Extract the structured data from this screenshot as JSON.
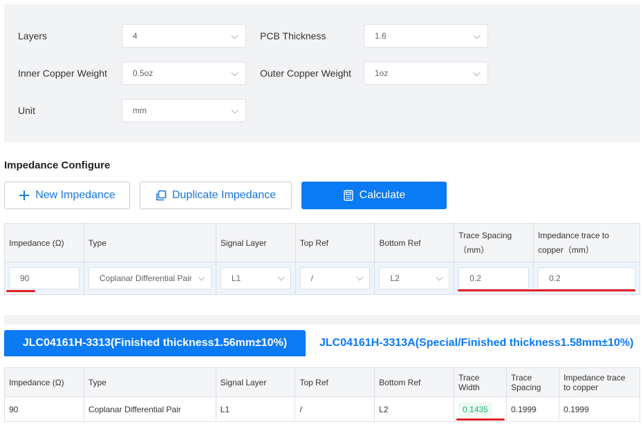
{
  "params": {
    "layers": {
      "label": "Layers",
      "value": "4"
    },
    "pcb_thickness": {
      "label": "PCB Thickness",
      "value": "1.6"
    },
    "inner_copper": {
      "label": "Inner Copper Weight",
      "value": "0.5oz"
    },
    "outer_copper": {
      "label": "Outer Copper Weight",
      "value": "1oz"
    },
    "unit": {
      "label": "Unit",
      "value": "mm"
    }
  },
  "impedance": {
    "title": "Impedance Configure",
    "new_label": "New Impedance",
    "duplicate_label": "Duplicate Impedance",
    "calculate_label": "Calculate",
    "headers": {
      "impedance": "Impedance (Ω)",
      "type": "Type",
      "signal_layer": "Signal Layer",
      "top_ref": "Top Ref",
      "bottom_ref": "Bottom Ref",
      "trace_spacing_1": "Trace Spacing",
      "trace_spacing_2": "（mm）",
      "trace_copper_1": "Impedance trace to",
      "trace_copper_2": "copper（mm）"
    },
    "row": {
      "impedance": "90",
      "type": "Coplanar Differential Pair",
      "signal_layer": "L1",
      "top_ref": "/",
      "bottom_ref": "L2",
      "trace_spacing": "0.2",
      "trace_copper": "0.2"
    }
  },
  "tabs": {
    "active": "JLC04161H-3313(Finished thickness1.56mm±10%)",
    "other": "JLC04161H-3313A(Special/Finished thickness1.58mm±10%)"
  },
  "results": {
    "headers": {
      "impedance": "Impedance (Ω)",
      "type": "Type",
      "signal_layer": "Signal Layer",
      "top_ref": "Top Ref",
      "bottom_ref": "Bottom Ref",
      "trace_width_1": "Trace",
      "trace_width_2": "Width",
      "trace_spacing_1": "Trace",
      "trace_spacing_2": "Spacing",
      "trace_copper_1": "Impedance trace",
      "trace_copper_2": "to copper"
    },
    "row": {
      "impedance": "90",
      "type": "Coplanar Differential Pair",
      "signal_layer": "L1",
      "top_ref": "/",
      "bottom_ref": "L2",
      "trace_width": "0.1435",
      "trace_spacing": "0.1999",
      "trace_copper": "0.1999"
    }
  },
  "colors": {
    "accent": "#0a7af5",
    "highlight_red": "#e02020",
    "result_green": "#19b36b"
  }
}
